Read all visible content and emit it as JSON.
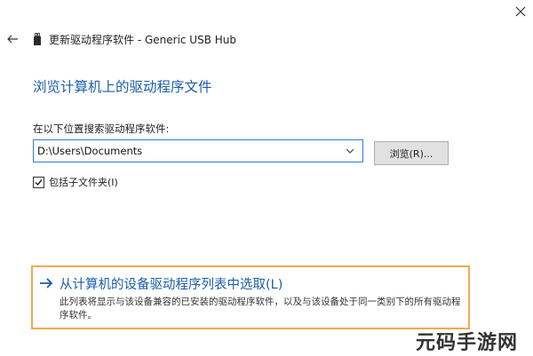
{
  "window": {
    "title": "更新驱动程序软件 - Generic USB Hub"
  },
  "page": {
    "heading": "浏览计算机上的驱动程序文件"
  },
  "search": {
    "label": "在以下位置搜索驱动程序软件:",
    "path_value": "D:\\Users\\Documents",
    "browse_label": "浏览(R)..."
  },
  "subfolders": {
    "label": "包括子文件夹(I)",
    "checked": true
  },
  "pick_option": {
    "title": "从计算机的设备驱动程序列表中选取(L)",
    "description": "此列表将显示与该设备兼容的已安装的驱动程序软件，以及与该设备处于同一类别下的所有驱动程序软件。"
  },
  "watermark": {
    "text": "元码手游网"
  },
  "icons": {
    "close": "close-icon",
    "back": "back-arrow-icon",
    "device": "usb-device-icon",
    "dropdown": "chevron-down-icon",
    "option_arrow": "arrow-right-icon"
  },
  "colors": {
    "accent_blue": "#1a5ea8",
    "focus_border": "#2f7bd8",
    "highlight_border": "#f2a851"
  }
}
